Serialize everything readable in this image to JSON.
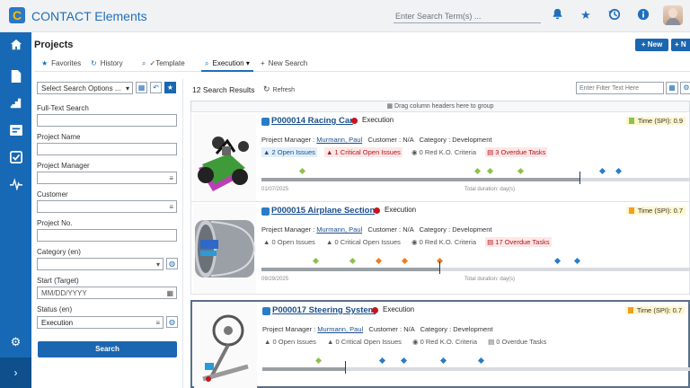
{
  "app": {
    "title": "CONTACT Elements",
    "logo_letter": "C",
    "search_placeholder": "Enter Search Term(s) ...",
    "icons": [
      "bell-icon",
      "star-icon",
      "history-icon",
      "info-icon"
    ]
  },
  "page": {
    "title": "Projects",
    "new_label": "+ New",
    "more_label": "+ N"
  },
  "tabs": [
    {
      "label": "Favorites",
      "icon": "★"
    },
    {
      "label": "History",
      "icon": "↻"
    },
    {
      "label": "✓Template",
      "icon": "⌕"
    },
    {
      "label": "Execution",
      "icon": "⌕",
      "active": true
    },
    {
      "label": "New Search",
      "icon": "+"
    }
  ],
  "search_panel": {
    "options_label": "Select Search Options ...",
    "fields": [
      {
        "label": "Full-Text Search",
        "value": ""
      },
      {
        "label": "Project Name",
        "value": ""
      },
      {
        "label": "Project Manager",
        "value": ""
      },
      {
        "label": "Customer",
        "value": ""
      },
      {
        "label": "Project No.",
        "value": ""
      },
      {
        "label": "Category (en)",
        "value": ""
      },
      {
        "label": "Start (Target)",
        "value": "",
        "placeholder": "MM/DD/YYYY"
      },
      {
        "label": "Status (en)",
        "value": "Execution"
      }
    ],
    "search_button": "Search"
  },
  "results": {
    "count_label": "12 Search Results",
    "refresh_label": "Refresh",
    "filter_placeholder": "Enter Filter Text Here",
    "group_hint": "Drag column headers here to group"
  },
  "projects": [
    {
      "title": "P000014 Racing Car",
      "status": "Execution",
      "spi_label": "Time (SPI): 0.9",
      "spi_color": "#8bc34a",
      "manager_label": "Project Manager :",
      "manager": "Murmann, Paul",
      "customer_label": "Customer :",
      "customer": "N/A",
      "category_label": "Category :",
      "category": "Development",
      "open_issues": "2 Open Issues",
      "critical_issues": "1 Critical Open Issues",
      "ko_criteria": "0 Red K.O. Criteria",
      "overdue": "3 Overdue Tasks",
      "start_date": "01/07/2025",
      "total_label": "Total duration: day(s)",
      "progress": 0.74
    },
    {
      "title": "P000015 Airplane Section",
      "status": "Execution",
      "spi_label": "Time (SPI): 0.7",
      "spi_color": "#f0a020",
      "manager_label": "Project Manager :",
      "manager": "Murmann, Paul",
      "customer_label": "Customer :",
      "customer": "N/A",
      "category_label": "Category :",
      "category": "Development",
      "open_issues": "0 Open Issues",
      "critical_issues": "0 Critical Open Issues",
      "ko_criteria": "0 Red K.O. Criteria",
      "overdue": "17 Overdue Tasks",
      "start_date": "09/29/2025",
      "total_label": "Total duration: day(s)",
      "progress": 0.41
    },
    {
      "title": "P000017 Steering System",
      "status": "Execution",
      "spi_label": "Time (SPI): 0.7",
      "spi_color": "#f0a020",
      "manager_label": "Project Manager :",
      "manager": "Murmann, Paul",
      "customer_label": "Customer :",
      "customer": "N/A",
      "category_label": "Category :",
      "category": "Development",
      "open_issues": "0 Open Issues",
      "critical_issues": "0 Critical Open Issues",
      "ko_criteria": "0 Red K.O. Criteria",
      "overdue": "0 Overdue Tasks",
      "start_date": "",
      "total_label": "",
      "progress": 0.19
    }
  ]
}
